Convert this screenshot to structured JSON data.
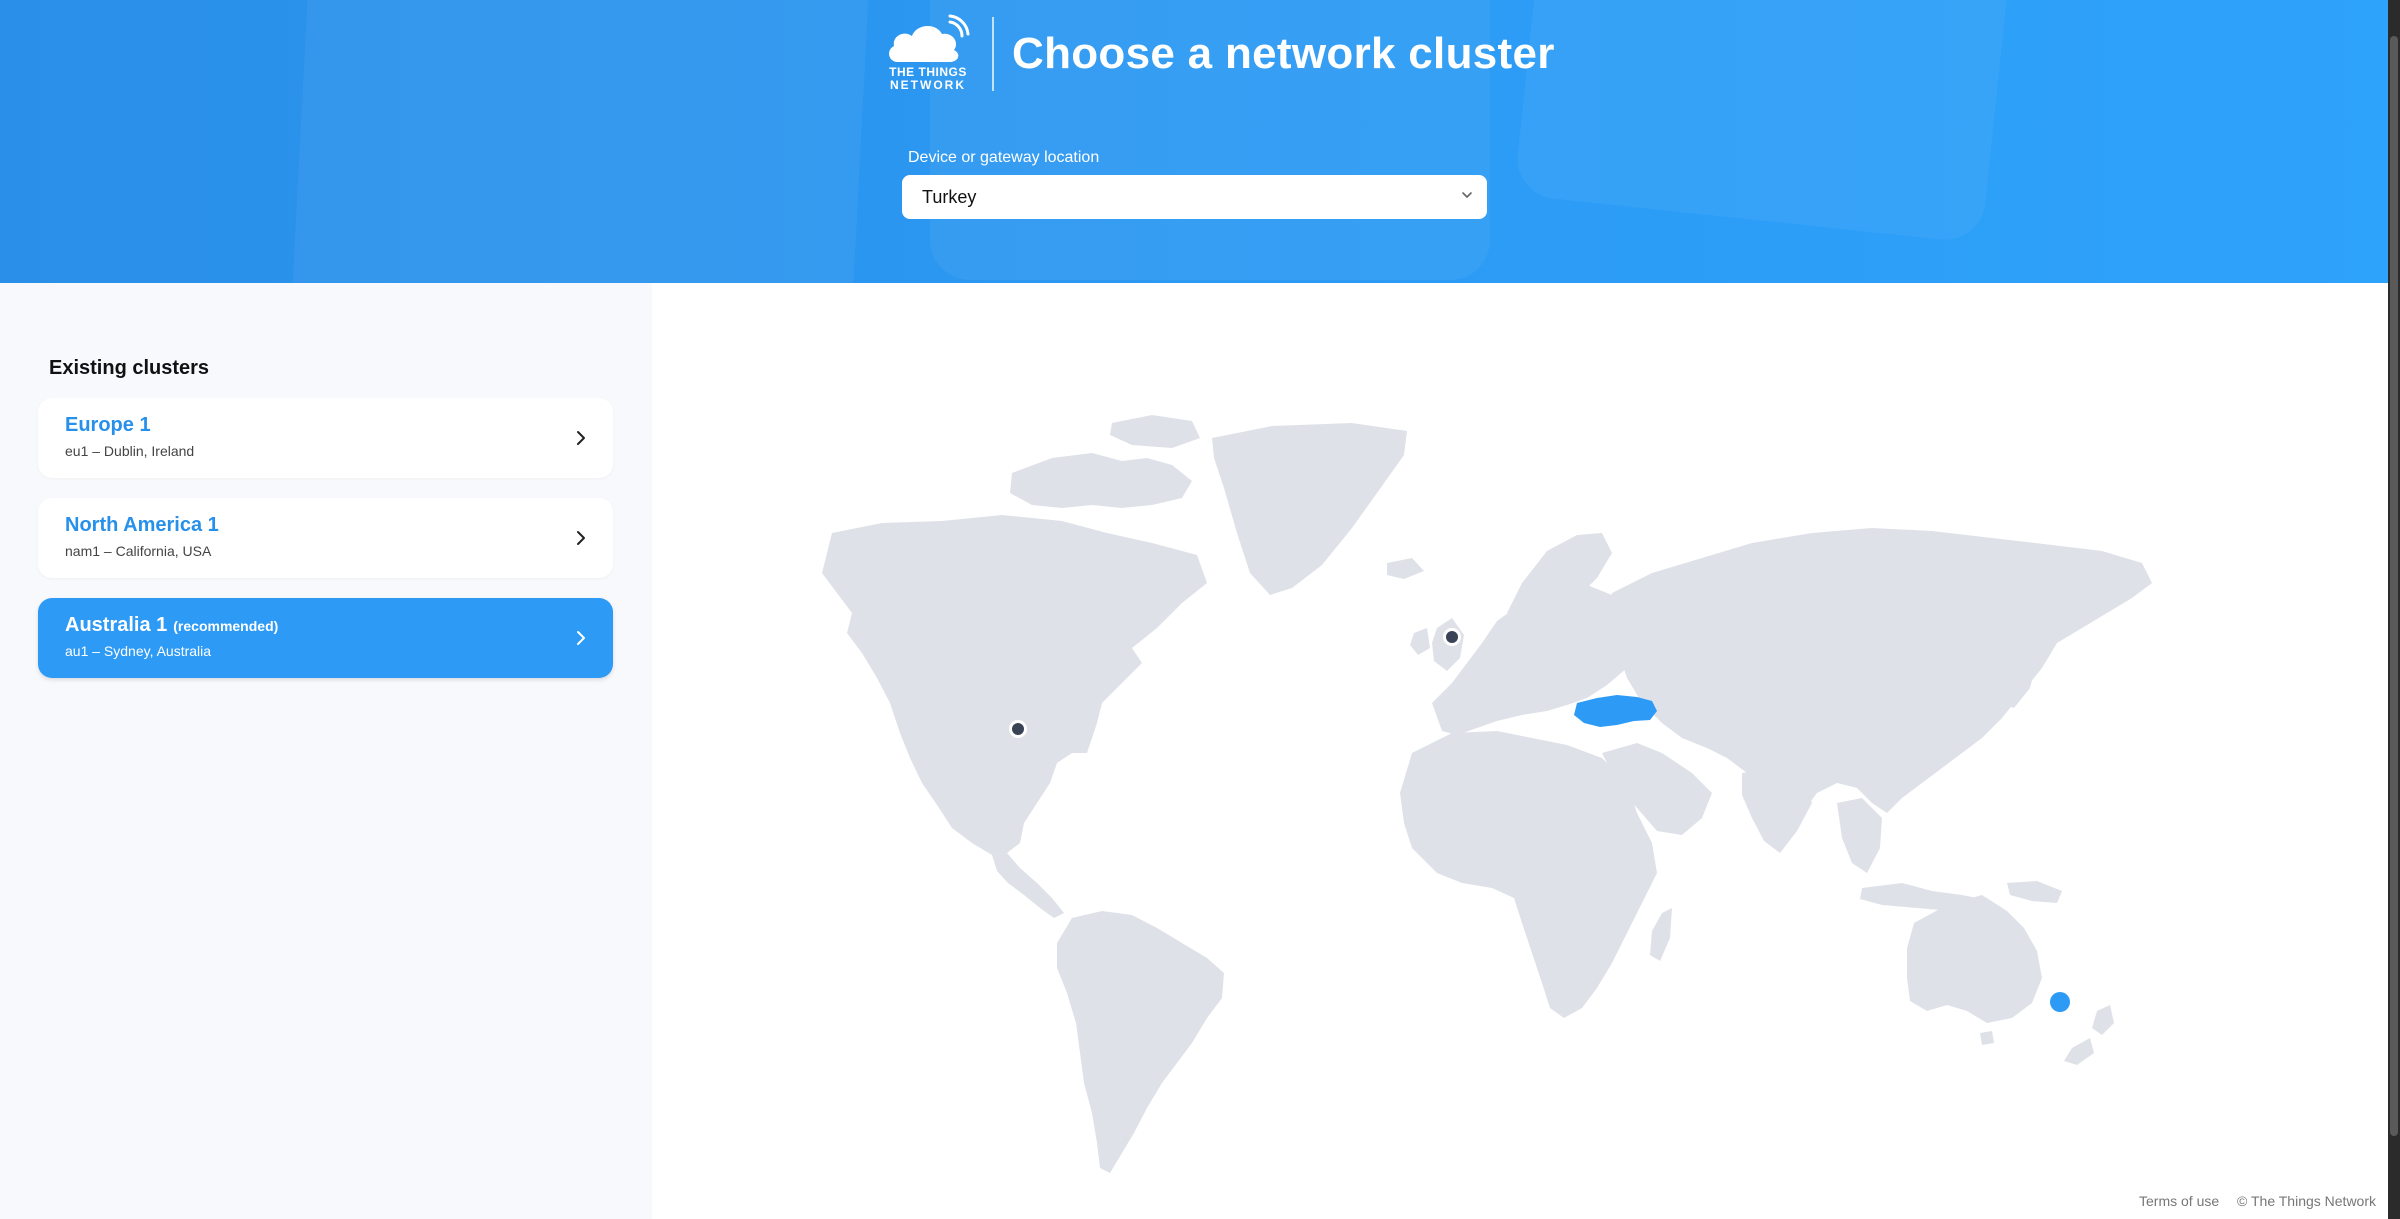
{
  "header": {
    "logo": {
      "line1": "THE THINGS",
      "line2": "NETWORK"
    },
    "title": "Choose a network cluster",
    "location_label": "Device or gateway location",
    "location_value": "Turkey"
  },
  "sidebar": {
    "section_title": "Existing clusters",
    "clusters": [
      {
        "name": "Europe 1",
        "location": "eu1 – Dublin, Ireland",
        "badge": "",
        "selected": false
      },
      {
        "name": "North America 1",
        "location": "nam1 – California, USA",
        "badge": "",
        "selected": false
      },
      {
        "name": "Australia 1",
        "location": "au1 – Sydney, Australia",
        "badge": "(recommended)",
        "selected": true
      }
    ]
  },
  "map": {
    "highlighted_country": "Turkey",
    "markers": [
      "Dublin",
      "California",
      "Sydney"
    ]
  },
  "footer": {
    "terms": "Terms of use",
    "copyright": "© The Things Network"
  },
  "colors": {
    "brand_blue": "#2d9af6",
    "land_gray": "#dfe1e8",
    "marker_dark": "#3a4356"
  },
  "icons": [
    "ttn-cloud-logo-icon",
    "chevron-down-icon",
    "chevron-right-icon"
  ]
}
